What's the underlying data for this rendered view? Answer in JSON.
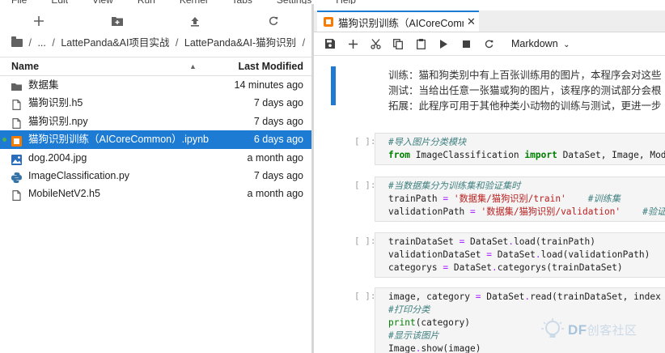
{
  "menu": [
    "File",
    "Edit",
    "View",
    "Run",
    "Kernel",
    "Tabs",
    "Settings",
    "Help"
  ],
  "file_browser": {
    "toolbar": {
      "new_icon": "plus-icon",
      "upload_folder_icon": "new-folder-icon",
      "upload_icon": "upload-icon",
      "refresh_icon": "refresh-icon"
    },
    "breadcrumb": [
      "...",
      "LattePanda&AI项目实战",
      "LattePanda&AI-猫狗识别"
    ],
    "header": {
      "name": "Name",
      "modified": "Last Modified"
    },
    "items": [
      {
        "name": "数据集",
        "modified": "14 minutes ago",
        "icon": "folder-icon"
      },
      {
        "name": "猫狗识别.h5",
        "modified": "7 days ago",
        "icon": "file-icon"
      },
      {
        "name": "猫狗识别.npy",
        "modified": "7 days ago",
        "icon": "file-icon"
      },
      {
        "name": "猫狗识别训练（AICoreCommon）.ipynb",
        "modified": "6 days ago",
        "icon": "notebook-icon"
      },
      {
        "name": "dog.2004.jpg",
        "modified": "a month ago",
        "icon": "image-icon"
      },
      {
        "name": "ImageClassification.py",
        "modified": "7 days ago",
        "icon": "python-icon"
      },
      {
        "name": "MobileNetV2.h5",
        "modified": "a month ago",
        "icon": "file-icon"
      }
    ]
  },
  "notebook": {
    "tab_label": "猫狗识别训练（AICoreComm",
    "toolbar": {
      "cell_type": "Markdown"
    },
    "markdown_lines": [
      "训练：猫和狗类别中有上百张训练用的图片，本程序会对这些",
      "测试：当给出任意一张猫或狗的图片，该程序的测试部分会根",
      "拓展：此程序可用于其他种类小动物的训练与测试，更进一步"
    ],
    "cells": [
      {
        "prompt": "[ ]:",
        "lines": [
          [
            {
              "t": "#导入图片分类模块",
              "c": "comment"
            }
          ],
          [
            {
              "t": "from",
              "c": "kw"
            },
            {
              "t": " ImageClassification ",
              "c": ""
            },
            {
              "t": "import",
              "c": "kw"
            },
            {
              "t": " DataSet, Image, Model",
              "c": ""
            }
          ]
        ]
      },
      {
        "prompt": "[ ]:",
        "lines": [
          [
            {
              "t": "#当数据集分为训练集和验证集时",
              "c": "comment"
            }
          ],
          [
            {
              "t": "trainPath ",
              "c": ""
            },
            {
              "t": "=",
              "c": "op"
            },
            {
              "t": " ",
              "c": ""
            },
            {
              "t": "'数据集/猫狗识别/train'",
              "c": "str"
            },
            {
              "t": "    ",
              "c": ""
            },
            {
              "t": "#训练集",
              "c": "comment"
            }
          ],
          [
            {
              "t": "validationPath ",
              "c": ""
            },
            {
              "t": "=",
              "c": "op"
            },
            {
              "t": " ",
              "c": ""
            },
            {
              "t": "'数据集/猫狗识别/validation'",
              "c": "str"
            },
            {
              "t": "    ",
              "c": ""
            },
            {
              "t": "#验证集",
              "c": "comment"
            }
          ]
        ]
      },
      {
        "prompt": "[ ]:",
        "lines": [
          [
            {
              "t": "trainDataSet ",
              "c": ""
            },
            {
              "t": "=",
              "c": "op"
            },
            {
              "t": " DataSet",
              "c": ""
            },
            {
              "t": ".",
              "c": "op"
            },
            {
              "t": "load(trainPath)",
              "c": ""
            }
          ],
          [
            {
              "t": "validationDataSet ",
              "c": ""
            },
            {
              "t": "=",
              "c": "op"
            },
            {
              "t": " DataSet",
              "c": ""
            },
            {
              "t": ".",
              "c": "op"
            },
            {
              "t": "load(validationPath)",
              "c": ""
            }
          ],
          [
            {
              "t": "categorys ",
              "c": ""
            },
            {
              "t": "=",
              "c": "op"
            },
            {
              "t": " DataSet",
              "c": ""
            },
            {
              "t": ".",
              "c": "op"
            },
            {
              "t": "categorys(trainDataSet)",
              "c": ""
            }
          ]
        ]
      },
      {
        "prompt": "[ ]:",
        "lines": [
          [
            {
              "t": "image, category ",
              "c": ""
            },
            {
              "t": "=",
              "c": "op"
            },
            {
              "t": " DataSet",
              "c": ""
            },
            {
              "t": ".",
              "c": "op"
            },
            {
              "t": "read(trainDataSet, index ",
              "c": ""
            },
            {
              "t": "=",
              "c": "op"
            }
          ],
          [
            {
              "t": "#打印分类",
              "c": "comment"
            }
          ],
          [
            {
              "t": "print",
              "c": "fn"
            },
            {
              "t": "(category)",
              "c": ""
            }
          ],
          [
            {
              "t": "#显示该图片",
              "c": "comment"
            }
          ],
          [
            {
              "t": "Image",
              "c": ""
            },
            {
              "t": ".",
              "c": "op"
            },
            {
              "t": "show(image)",
              "c": ""
            }
          ]
        ]
      }
    ]
  },
  "watermark": {
    "brand": "DF",
    "cn": "创客社区"
  },
  "colors": {
    "accent": "#1e7bd3",
    "notebook": "#f57c00",
    "comment": "#408080",
    "keyword": "#008000",
    "string": "#ba2121"
  }
}
